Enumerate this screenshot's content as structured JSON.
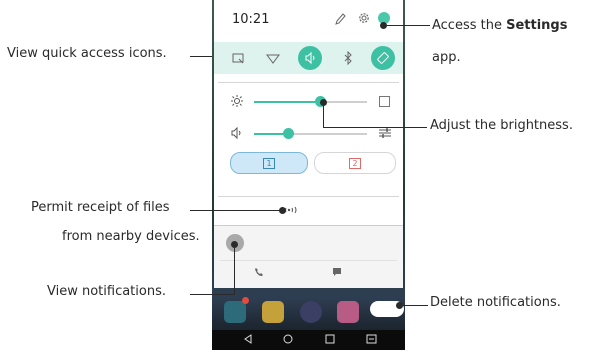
{
  "status_bar": {
    "time": "10:21"
  },
  "quick_tiles": [
    {
      "icon": "screen-capture-icon",
      "active": false
    },
    {
      "icon": "wifi-icon",
      "active": false
    },
    {
      "icon": "sound-icon",
      "active": true
    },
    {
      "icon": "bluetooth-icon",
      "active": false
    },
    {
      "icon": "auto-rotate-icon",
      "active": true
    }
  ],
  "sliders": {
    "brightness": {
      "level": 0.58
    },
    "volume": {
      "level": 0.3
    }
  },
  "sim_cards": [
    {
      "label": "1",
      "active": true
    },
    {
      "label": "2",
      "active": false
    }
  ],
  "callouts": {
    "quick_access": "View quick access icons.",
    "settings_prefix": "Access  the ",
    "settings_bold": "Settings",
    "settings_suffix": "app.",
    "brightness": "Adjust the brightness.",
    "nearby_line1": "Permit receipt of files",
    "nearby_line2": "from nearby devices.",
    "notifications": "View notifications.",
    "delete": "Delete notifications."
  },
  "colors": {
    "accent": "#3ec0a3",
    "sim2": "#e06a6a"
  }
}
